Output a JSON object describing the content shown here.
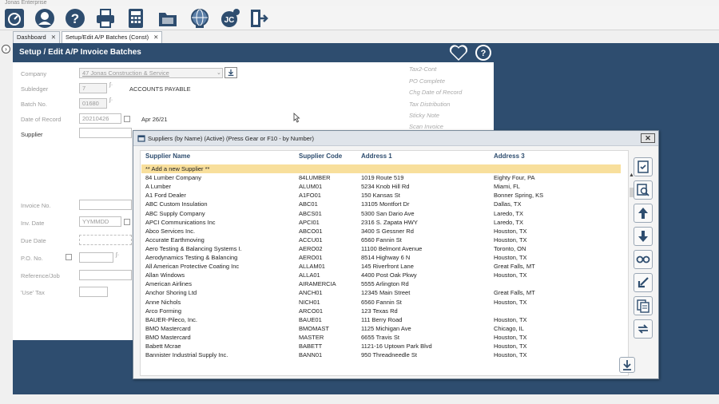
{
  "app_title": "Jonas Enterprise",
  "tabs": [
    {
      "label": "Dashboard",
      "close": "✕"
    },
    {
      "label": "Setup/Edit A/P Batches (Const)",
      "close": "✕"
    }
  ],
  "header": {
    "title": "Setup / Edit A/P Invoice Batches",
    "help": "?"
  },
  "form": {
    "company_label": "Company",
    "company_value": "47 Jonas Construction & Service",
    "subledger_label": "Subledger",
    "subledger_value": "7",
    "subledger_desc": "ACCOUNTS PAYABLE",
    "batch_label": "Batch No.",
    "batch_value": "01680",
    "date_label": "Date of Record",
    "date_value": "20210426",
    "date_text": "Apr 26/21",
    "supplier_label": "Supplier",
    "invoice_label": "Invoice No.",
    "invdate_label": "Inv. Date",
    "invdate_placeholder": "YYMMDD",
    "duedate_label": "Due Date",
    "po_label": "P.O. No.",
    "reference_label": "Reference/Job",
    "usetax_label": "'Use' Tax"
  },
  "side_links": [
    "Tax2-Cont",
    "PO Complete",
    "Chg Date of Record",
    "Tax Distribution",
    "Sticky Note",
    "Scan Invoice"
  ],
  "popup": {
    "title": "Suppliers (by Name)  (Active) (Press Gear or F10 - by Number)",
    "close": "✕",
    "columns": [
      "Supplier Name",
      "Supplier Code",
      "Address 1",
      "Address 3"
    ],
    "add_row": "** Add a new Supplier **",
    "rows": [
      [
        "84 Lumber Company",
        "84LUMBER",
        "1019 Route 519",
        "Eighty Four, PA"
      ],
      [
        "A Lumber",
        "ALUM01",
        "5234 Knob Hill Rd",
        "Miami, FL"
      ],
      [
        "A1 Ford Dealer",
        "A1FO01",
        "150 Kansas St",
        "Bonner Spring, KS"
      ],
      [
        "ABC Custom Insulation",
        "ABC01",
        "13105 Montfort Dr",
        "Dallas, TX"
      ],
      [
        "ABC Supply Company",
        "ABCS01",
        "5300 San Dario Ave",
        "Laredo, TX"
      ],
      [
        "APCI Communications Inc",
        "APCI01",
        "2316 S. Zapata HWY",
        "Laredo, TX"
      ],
      [
        "Abco Services Inc.",
        "ABCO01",
        "3400 S Gessner Rd",
        "Houston, TX"
      ],
      [
        "Accurate Earthmoving",
        "ACCU01",
        "6560 Fannin St",
        "Houston, TX"
      ],
      [
        "Aero Testing & Balancing Systems I.",
        "AERO02",
        "11100 Belmont Avenue",
        "Toronto, ON"
      ],
      [
        "Aerodynamics Testing & Balancing",
        "AERO01",
        "8514 Highway 6 N",
        "Houston, TX"
      ],
      [
        "All American Protective Coating Inc",
        "ALLAM01",
        "145 Riverfront Lane",
        "Great Falls, MT"
      ],
      [
        "Allan Windows",
        "ALLA01",
        "4400 Post Oak Pkwy",
        "Houston, TX"
      ],
      [
        "American Airlines",
        "AIRAMERCIA",
        "5555 Arlington Rd",
        ""
      ],
      [
        "Anchor Shoring Ltd",
        "ANCH01",
        "12345 Main Street",
        "Great Falls, MT"
      ],
      [
        "Anne Nichols",
        "NICH01",
        "6560 Fannin St",
        "Houston, TX"
      ],
      [
        "Arco Forming",
        "ARCO01",
        "123 Texas Rd",
        ""
      ],
      [
        "BAUER-Pileco, Inc.",
        "BAUE01",
        "111 Berry Road",
        "Houston, TX"
      ],
      [
        "BMO Mastercard",
        "BMOMAST",
        "1125 Michigan Ave",
        "Chicago, IL"
      ],
      [
        "BMO Mastercard",
        "MASTER",
        "6655 Travis St",
        "Houston, TX"
      ],
      [
        "Babett Mcrae",
        "BABETT",
        "1121-16 Uptown Park Blvd",
        "Houston, TX"
      ],
      [
        "Bannister Industrial Supply Inc.",
        "BANN01",
        "950 Threadneedle St",
        "Houston, TX"
      ]
    ]
  },
  "colors": {
    "navy": "#2e4d6f",
    "highlight": "#f8df9c"
  }
}
